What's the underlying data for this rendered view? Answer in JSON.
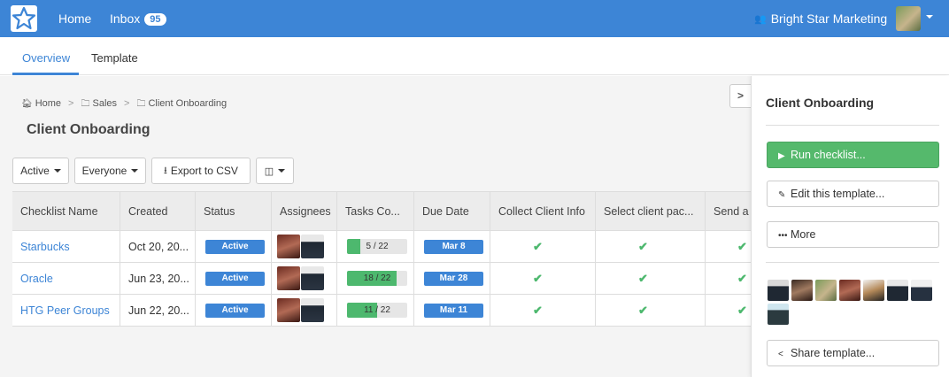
{
  "nav": {
    "home": "Home",
    "inbox": "Inbox",
    "inbox_count": "95",
    "org": "Bright Star Marketing"
  },
  "tabs": [
    {
      "label": "Overview"
    },
    {
      "label": "Template"
    }
  ],
  "breadcrumb": [
    "Home",
    "Sales",
    "Client Onboarding"
  ],
  "page_title": "Client Onboarding",
  "toolbar": {
    "active": "Active",
    "everyone": "Everyone",
    "export": "Export to CSV"
  },
  "table": {
    "headers": [
      "Checklist Name",
      "Created",
      "Status",
      "Assignees",
      "Tasks Co...",
      "Due Date",
      "Collect Client Info",
      "Select client pac...",
      "Send a"
    ],
    "rows": [
      {
        "name": "Starbucks",
        "created": "Oct 20, 20...",
        "status": "Active",
        "tasks": "5 / 22",
        "tasks_done": 5,
        "tasks_total": 22,
        "due": "Mar 8"
      },
      {
        "name": "Oracle",
        "created": "Jun 23, 20...",
        "status": "Active",
        "tasks": "18 / 22",
        "tasks_done": 18,
        "tasks_total": 22,
        "due": "Mar 28"
      },
      {
        "name": "HTG Peer Groups",
        "created": "Jun 22, 20...",
        "status": "Active",
        "tasks": "11 / 22",
        "tasks_done": 11,
        "tasks_total": 22,
        "due": "Mar 11"
      }
    ]
  },
  "panel": {
    "title": "Client Onboarding",
    "run": "Run checklist...",
    "edit": "Edit this template...",
    "more": "More",
    "share": "Share template..."
  },
  "colors": {
    "brand": "#3d85d6",
    "success": "#4db86e"
  }
}
